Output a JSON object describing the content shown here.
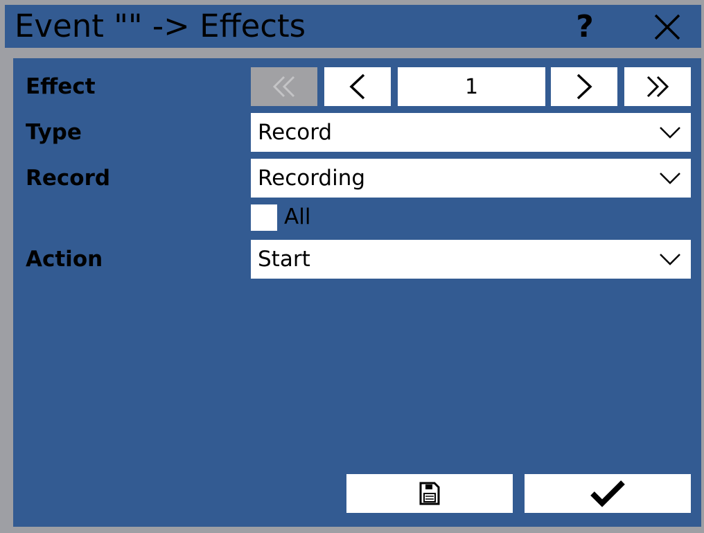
{
  "window": {
    "title": "Event \"\" -> Effects",
    "help_icon": "?",
    "close_icon": "close-icon"
  },
  "form": {
    "effect": {
      "label": "Effect",
      "page": "1",
      "first_disabled": true
    },
    "type": {
      "label": "Type",
      "value": "Record"
    },
    "record": {
      "label": "Record",
      "value": "Recording"
    },
    "all": {
      "label": "All",
      "checked": false
    },
    "action": {
      "label": "Action",
      "value": "Start"
    }
  },
  "footer": {
    "save_icon": "save-icon",
    "confirm_icon": "checkmark-icon"
  },
  "colors": {
    "panel": "#335b92",
    "frame": "#9e9fa4",
    "disabled": "#a1a1a4"
  }
}
